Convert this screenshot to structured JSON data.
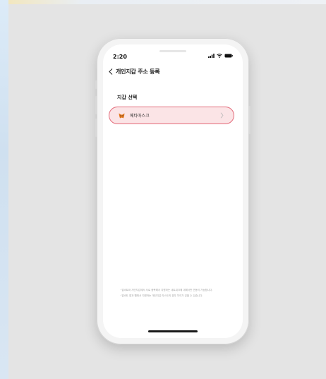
{
  "status_bar": {
    "time": "2:20"
  },
  "nav": {
    "title": "개인지갑 주소 등록"
  },
  "section": {
    "title": "지갑 선택"
  },
  "wallet": {
    "label": "메타마스크"
  },
  "notes": [
    "· 업비트와 개인지갑에서 서로 중복해서 지원하는 네트워크에 대해서만 연동이 가능합니다.",
    "· 업비트 앱과 웹에서 지원하는 개인지갑 리스트의 경우 차이가 있을 수 있습니다."
  ],
  "colors": {
    "highlight_border": "#e36b7a",
    "highlight_fill": "#fbe4e6"
  }
}
